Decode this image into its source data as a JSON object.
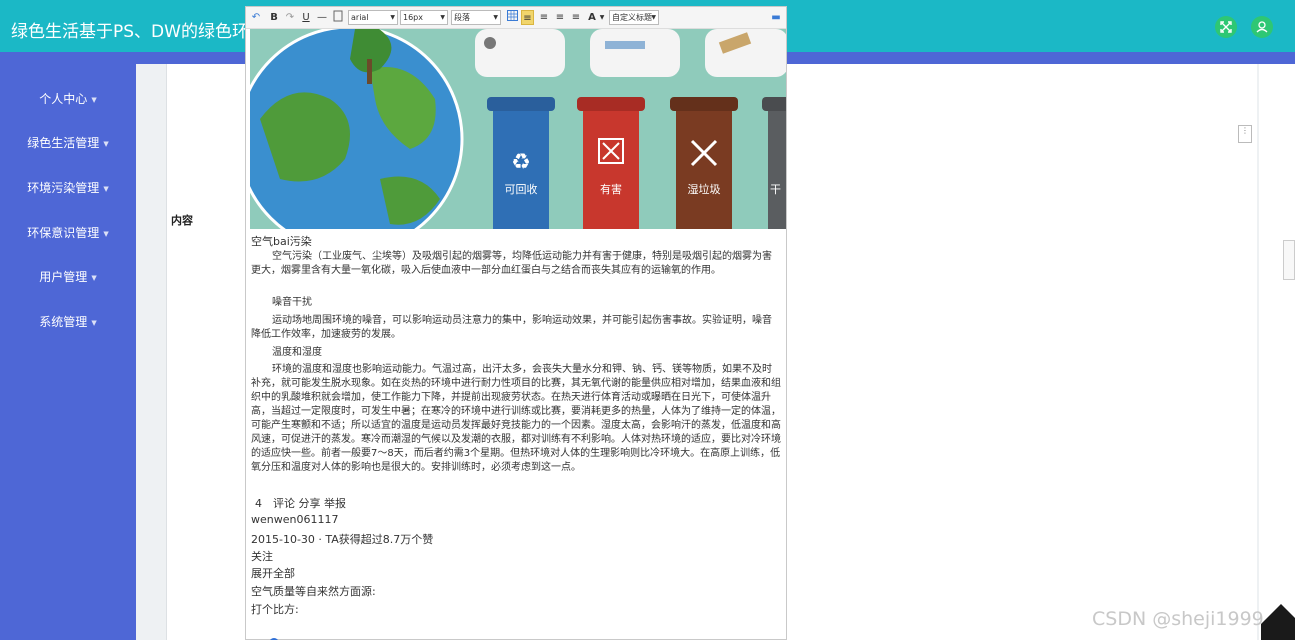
{
  "header": {
    "title": "绿色生活基于PS、DW的绿色环",
    "fullscreen_icon": "expand-icon",
    "user_icon": "user-icon"
  },
  "sidebar": {
    "items": [
      {
        "label": "个人中心"
      },
      {
        "label": "绿色生活管理"
      },
      {
        "label": "环境污染管理"
      },
      {
        "label": "环保意识管理"
      },
      {
        "label": "用户管理"
      },
      {
        "label": "系统管理"
      }
    ]
  },
  "form": {
    "content_label": "内容"
  },
  "editor": {
    "toolbar": {
      "bold": "B",
      "italic": "I",
      "underline": "U",
      "font_family": "arial",
      "font_size": "16px",
      "paragraph": "段落",
      "custom_title": "自定义标题",
      "font_color": "A"
    },
    "illustration": {
      "bins": [
        {
          "label": "可回收",
          "color": "#2f6fb5"
        },
        {
          "label": "有害",
          "color": "#c8372d"
        },
        {
          "label": "湿垃圾",
          "color": "#7a3b22"
        },
        {
          "label": "干",
          "color": "#5a5d60"
        }
      ]
    },
    "doc": {
      "heading": "空气bai污染",
      "p1": "空气污染（工业废气、尘埃等）及吸烟引起的烟雾等，均降低运动能力并有害于健康，特别是吸烟引起的烟雾为害更大，烟雾里含有大量一氧化碳，吸入后使血液中一部分血红蛋白与之结合而丧失其应有的运输氧的作用。",
      "sub1": "噪音干扰",
      "p2": "运动场地周围环境的噪音，可以影响运动员注意力的集中，影响运动效果，并可能引起伤害事故。实验证明，噪音降低工作效率，加速疲劳的发展。",
      "sub2": "温度和湿度",
      "p3": "环境的温度和湿度也影响运动能力。气温过高，出汗太多，会丧失大量水分和钾、钠、钙、镁等物质，如果不及时补充，就可能发生脱水现象。如在炎热的环境中进行耐力性项目的比赛，其无氧代谢的能量供应相对增加，结果血液和组织中的乳酸堆积就会增加，使工作能力下降，并提前出现疲劳状态。在热天进行体育活动或曝晒在日光下，可使体温升高，当超过一定限度时，可发生中暑；在寒冷的环境中进行训练或比赛，要消耗更多的热量，人体为了维持一定的体温，可能产生寒颤和不适；所以适宜的温度是运动员发挥最好竞技能力的一个因素。湿度太高，会影响汗的蒸发，低温度和高风速，可促进汗的蒸发。寒冷而潮湿的气候以及发潮的衣服，都对训练有不利影响。人体对热环境的适应，要比对冷环境的适应快一些。前者一般要7～8天，而后者约需3个星期。但热环境对人体的生理影响则比冷环境大。在高原上训练，低氧分压和温度对人体的影响也是很大的。安排训练时，必须考虑到这一点。",
      "meta_line": "4　评论 分享 举报",
      "author": "wenwen061117",
      "date_line": "2015-10-30 · TA获得超过8.7万个赞",
      "follow": "关注",
      "expand_all": "展开全部",
      "line_a": "空气质量等自来然方面源:",
      "line_b": "打个比方:"
    }
  },
  "watermark": "CSDN @sheji1999",
  "colors": {
    "header_bg": "#1bb8c6",
    "sidebar_bg": "#4e67d6",
    "header_button": "#2ec774"
  }
}
